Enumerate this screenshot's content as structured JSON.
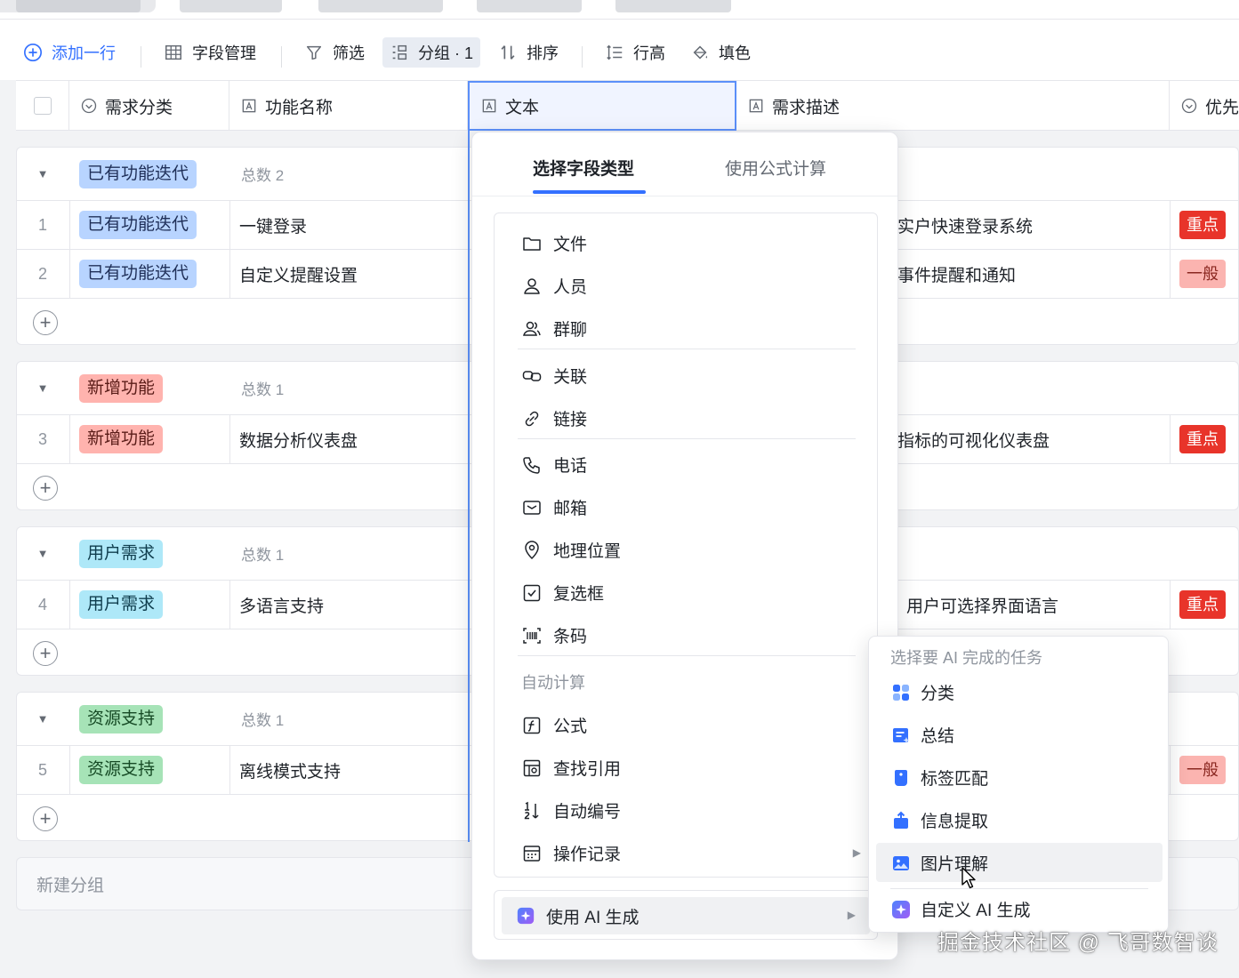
{
  "toolbar": {
    "add_row": "添加一行",
    "field_manage": "字段管理",
    "filter": "筛选",
    "group": "分组 · 1",
    "sort": "排序",
    "row_height": "行高",
    "fill_color": "填色"
  },
  "columns": {
    "category": "需求分类",
    "feature": "功能名称",
    "text": "文本",
    "description": "需求描述",
    "priority": "优先"
  },
  "groups": [
    {
      "label": "已有功能迭代",
      "count": "总数 2",
      "color": "#b8d4ff",
      "rows": [
        {
          "num": "1",
          "tag": "已有功能迭代",
          "feature": "一键登录",
          "desc": "实户快速登录系统",
          "priority": "重点"
        },
        {
          "num": "2",
          "tag": "已有功能迭代",
          "feature": "自定义提醒设置",
          "desc": "事件提醒和通知",
          "priority": "一般"
        }
      ]
    },
    {
      "label": "新增功能",
      "count": "总数 1",
      "color": "#ffb3ae",
      "rows": [
        {
          "num": "3",
          "tag": "新增功能",
          "feature": "数据分析仪表盘",
          "desc": "指标的可视化仪表盘",
          "priority": "重点"
        }
      ]
    },
    {
      "label": "用户需求",
      "count": "总数 1",
      "color": "#aee8f8",
      "rows": [
        {
          "num": "4",
          "tag": "用户需求",
          "feature": "多语言支持",
          "desc": "用户可选择界面语言",
          "priority": "重点"
        }
      ]
    },
    {
      "label": "资源支持",
      "count": "总数 1",
      "color": "#a6e3b7",
      "rows": [
        {
          "num": "5",
          "tag": "资源支持",
          "feature": "离线模式支持",
          "desc": "",
          "priority": "一般"
        }
      ]
    }
  ],
  "new_group": "新建分组",
  "popup": {
    "tab_select": "选择字段类型",
    "tab_formula": "使用公式计算",
    "items": {
      "file": "文件",
      "person": "人员",
      "group_chat": "群聊",
      "relation": "关联",
      "link": "链接",
      "phone": "电话",
      "email": "邮箱",
      "location": "地理位置",
      "checkbox": "复选框",
      "barcode": "条码",
      "auto_section": "自动计算",
      "formula": "公式",
      "lookup": "查找引用",
      "auto_number": "自动编号",
      "history": "操作记录"
    },
    "ai_generate": "使用 AI 生成"
  },
  "ai_submenu": {
    "title": "选择要 AI 完成的任务",
    "items": [
      "分类",
      "总结",
      "标签匹配",
      "信息提取",
      "图片理解",
      "自定义 AI 生成"
    ]
  },
  "watermark": "掘金技术社区 @ 飞哥数智谈",
  "colors": {
    "accent": "#3370ff",
    "priority_high": "#e8342a",
    "priority_normal": "#fbb4b0"
  }
}
